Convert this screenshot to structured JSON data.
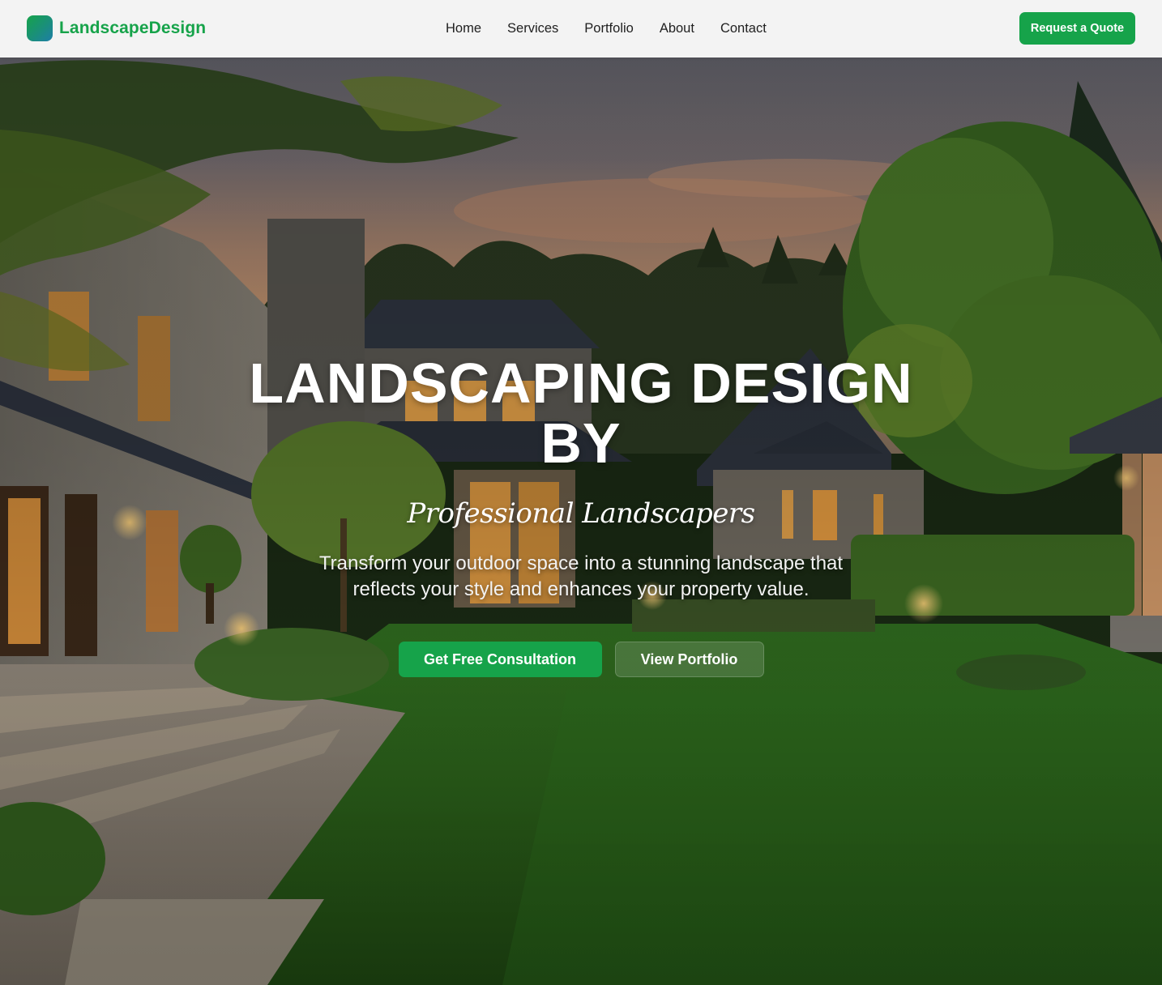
{
  "brand": {
    "name": "LandscapeDesign",
    "logo_icon": "brand-logo-icon"
  },
  "nav": {
    "links": [
      "Home",
      "Services",
      "Portfolio",
      "About",
      "Contact"
    ],
    "cta_label": "Request a Quote"
  },
  "hero": {
    "title": "LANDSCAPING DESIGN BY",
    "script_subtitle": "Professional Landscapers",
    "description": "Transform your outdoor space into a stunning landscape that reflects your style and enhances your property value.",
    "primary_button": "Get Free Consultation",
    "secondary_button": "View Portfolio",
    "background_image": "evening-house-lawn-landscape"
  },
  "colors": {
    "accent": "#16a34a",
    "navbar_bg": "#fafafa",
    "text_dark": "#1f1f1f",
    "text_light": "#ffffff"
  }
}
